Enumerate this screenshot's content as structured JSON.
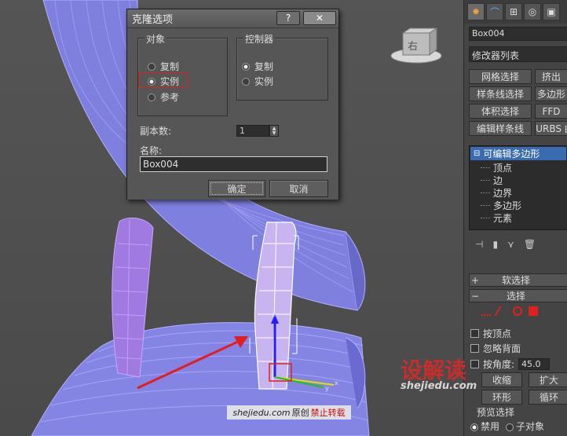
{
  "dialog": {
    "title": "克隆选项",
    "help_label": "?",
    "close_label": "✕",
    "object_group": {
      "label": "对象",
      "options": [
        "复制",
        "实例",
        "参考"
      ],
      "selected": "实例"
    },
    "controller_group": {
      "label": "控制器",
      "options": [
        "复制",
        "实例"
      ],
      "selected": "复制"
    },
    "copies_label": "副本数:",
    "copies_value": "1",
    "name_label": "名称:",
    "name_value": "Box004",
    "ok_label": "确定",
    "cancel_label": "取消"
  },
  "viewcube": {
    "face_label": "右"
  },
  "command_panel": {
    "tabs": [
      "create-icon",
      "modify-icon",
      "hierarchy-icon",
      "motion-icon",
      "display-icon"
    ],
    "object_name": "Box004",
    "modifier_list": "修改器列表",
    "buttons": [
      [
        "网格选择",
        "挤出"
      ],
      [
        "样条线选择",
        "多边形"
      ],
      [
        "体积选择",
        "FFD"
      ],
      [
        "编辑样条线",
        "NURBS 曲"
      ]
    ],
    "stack_root": "可编辑多边形",
    "stack_items": [
      "顶点",
      "边",
      "边界",
      "多边形",
      "元素"
    ],
    "soft_select": "软选择",
    "select": "选择",
    "by_vertex": "按顶点",
    "ignore_backface": "忽略背面",
    "by_angle_label": "按角度:",
    "by_angle_value": "45.0",
    "shrink": "收缩",
    "grow": "扩大",
    "ring": "环形",
    "loop": "循环",
    "preview_label": "预览选择",
    "preview_options": [
      "禁用",
      "子对象"
    ]
  },
  "watermark": {
    "logo": "设解读",
    "site": "shejiedu.com",
    "credit_site": "shejiedu.com",
    "credit_original": "原创",
    "credit_forbid": "禁止转载"
  }
}
